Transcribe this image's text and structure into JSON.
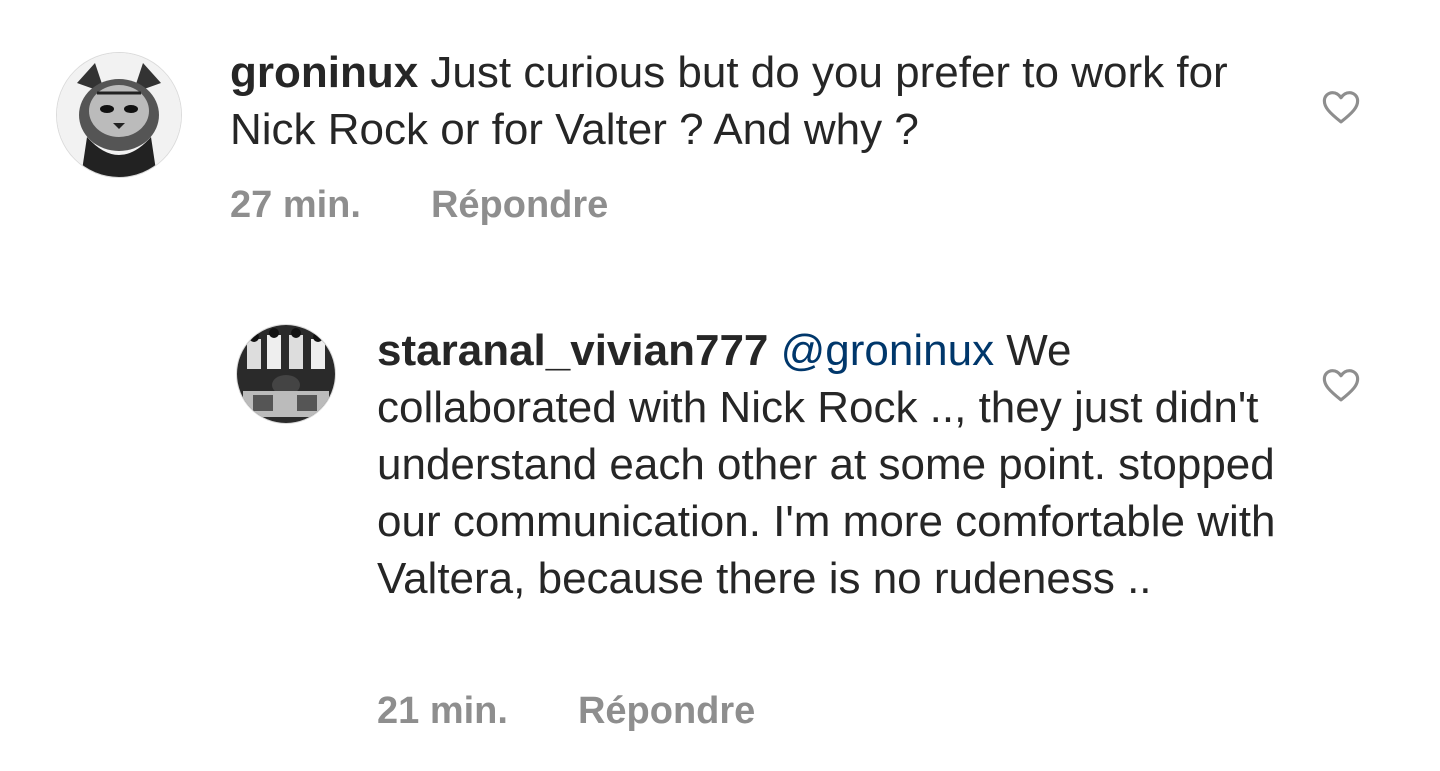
{
  "comments": [
    {
      "username": "groninux",
      "text": " Just curious but do you prefer to work for Nick Rock or for Valter ? And why ?",
      "time": "27 min.",
      "reply_label": "Répondre",
      "avatar_icon": "cat-portrait-avatar",
      "like_icon": "heart-outline-icon"
    },
    {
      "username": "staranal_vivian777",
      "mention": "@groninux",
      "text": " We collaborated with Nick Rock .., they just didn't understand each other at some point. stopped our communication. I'm more comfortable with Valtera, because there is no rudeness ..",
      "time": "21 min.",
      "reply_label": "Répondre",
      "avatar_icon": "group-photo-avatar",
      "like_icon": "heart-outline-icon"
    }
  ],
  "colors": {
    "text": "#262626",
    "secondary": "#8e8e8e",
    "mention": "#00376b",
    "background": "#ffffff"
  }
}
